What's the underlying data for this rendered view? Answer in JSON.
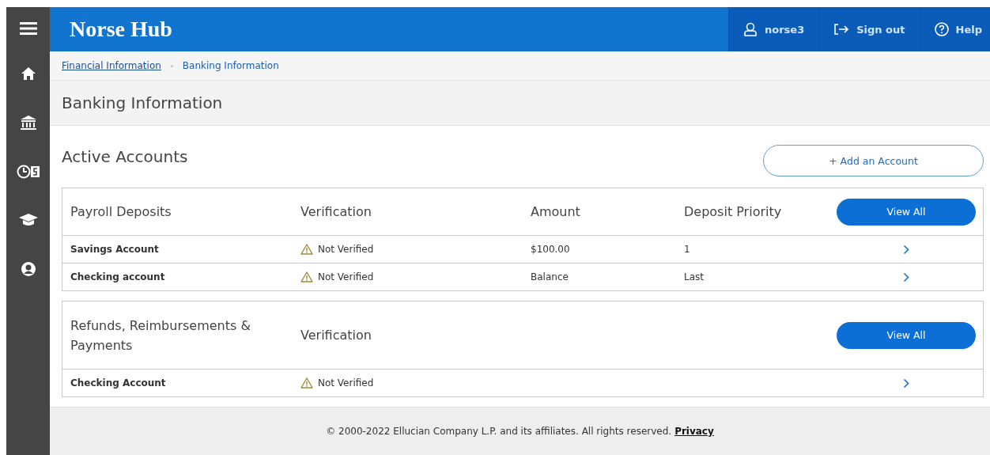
{
  "header": {
    "title": "Norse Hub",
    "user": "norse3",
    "sign_out": "Sign out",
    "help": "Help"
  },
  "breadcrumb": [
    {
      "label": "Financial Information",
      "kind": "link"
    },
    {
      "label": "Banking Information",
      "kind": "current"
    }
  ],
  "page_title": "Banking Information",
  "section": {
    "title": "Active Accounts",
    "add_button": "+ Add an Account"
  },
  "tables": [
    {
      "columns": [
        "Payroll Deposits",
        "Verification",
        "Amount",
        "Deposit Priority"
      ],
      "view_all": "View All",
      "rows": [
        {
          "cells": [
            {
              "text": "Savings Account",
              "kind": "name"
            },
            {
              "text": "Not Verified",
              "kind": "warning"
            },
            {
              "text": "$100.00",
              "kind": "plain"
            },
            {
              "text": "1",
              "kind": "plain"
            }
          ]
        },
        {
          "cells": [
            {
              "text": "Checking account",
              "kind": "name"
            },
            {
              "text": "Not Verified",
              "kind": "warning"
            },
            {
              "text": "Balance",
              "kind": "plain"
            },
            {
              "text": "Last",
              "kind": "plain"
            }
          ]
        }
      ]
    },
    {
      "columns": [
        "Refunds, Reimbursements & Payments",
        "Verification"
      ],
      "view_all": "View All",
      "rows": [
        {
          "cells": [
            {
              "text": "Checking Account",
              "kind": "name"
            },
            {
              "text": "Not Verified",
              "kind": "warning"
            }
          ]
        }
      ]
    }
  ],
  "footer": {
    "text": "© 2000-2022 Ellucian Company L.P. and its affiliates. All rights reserved.",
    "link": "Privacy"
  }
}
